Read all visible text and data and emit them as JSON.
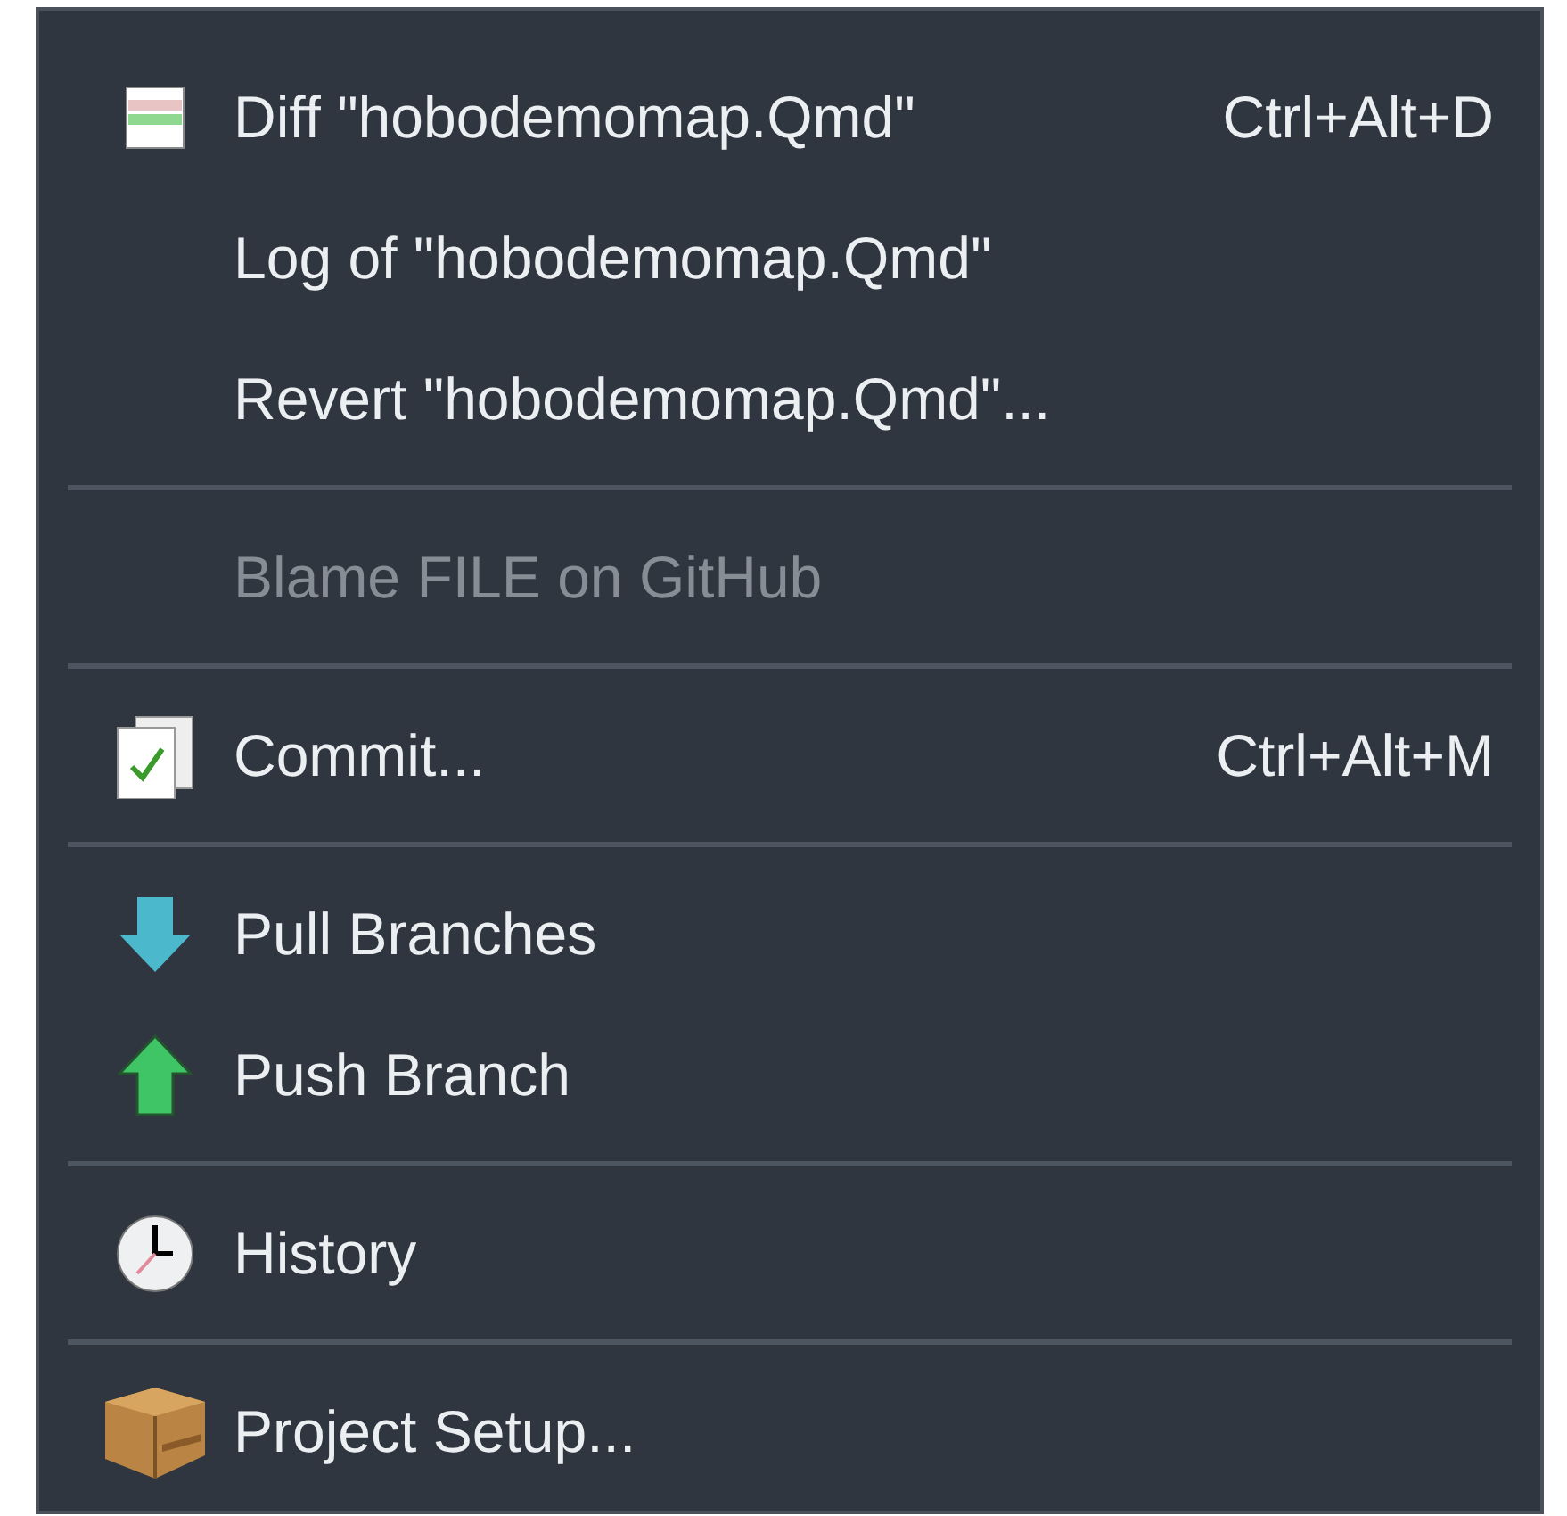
{
  "menu": {
    "items": [
      {
        "kind": "item",
        "label": "Diff \"hobodemomap.Qmd\"",
        "shortcut": "Ctrl+Alt+D",
        "disabled": false
      },
      {
        "kind": "item",
        "label": "Log of \"hobodemomap.Qmd\"",
        "disabled": false
      },
      {
        "kind": "item",
        "label": "Revert \"hobodemomap.Qmd\"...",
        "disabled": false
      },
      {
        "kind": "separator"
      },
      {
        "kind": "item",
        "label": "Blame FILE on GitHub",
        "disabled": true
      },
      {
        "kind": "separator"
      },
      {
        "kind": "item",
        "label": "Commit...",
        "shortcut": "Ctrl+Alt+M",
        "disabled": false
      },
      {
        "kind": "separator"
      },
      {
        "kind": "item",
        "label": "Pull Branches",
        "disabled": false
      },
      {
        "kind": "item",
        "label": "Push Branch",
        "disabled": false
      },
      {
        "kind": "separator"
      },
      {
        "kind": "item",
        "label": "History",
        "disabled": false
      },
      {
        "kind": "separator"
      },
      {
        "kind": "item",
        "label": "Project Setup...",
        "disabled": false
      }
    ]
  }
}
